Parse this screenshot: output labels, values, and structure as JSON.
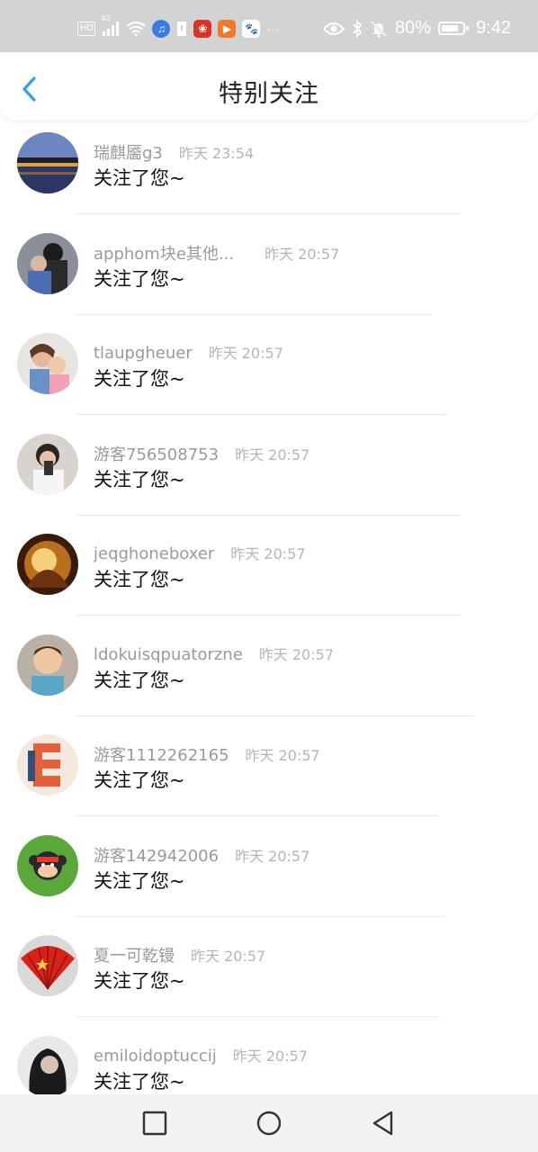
{
  "status_bar": {
    "hd": "HD",
    "network": "4G",
    "battery_text": "80%",
    "battery_level": 0.8,
    "time": "9:42",
    "more": "···",
    "icons": [
      "hd-icon",
      "signal-icon",
      "wifi-icon",
      "music-app-icon",
      "sim-icon",
      "huawei-app-icon",
      "video-app-icon",
      "baidu-app-icon",
      "eye-icon",
      "bluetooth-icon",
      "mute-bell-icon",
      "battery-icon"
    ]
  },
  "header": {
    "title": "特别关注",
    "back_icon": "chevron-left-icon",
    "accent_color": "#2f9ff0"
  },
  "list": {
    "items": [
      {
        "name": "瑞麒靥g3",
        "time": "昨天 23:54",
        "message": "关注了您~",
        "avatar": "lake-night-avatar"
      },
      {
        "name": "apphom块e其他...",
        "time": "昨天 20:57",
        "message": "关注了您~",
        "avatar": "couple-photo-avatar"
      },
      {
        "name": "tlaupgheuer",
        "time": "昨天 20:57",
        "message": "关注了您~",
        "avatar": "mother-child-avatar"
      },
      {
        "name": "游客756508753",
        "time": "昨天 20:57",
        "message": "关注了您~",
        "avatar": "selfie-avatar"
      },
      {
        "name": "jeqghoneboxer",
        "time": "昨天 20:57",
        "message": "关注了您~",
        "avatar": "fire-girl-avatar"
      },
      {
        "name": "ldokuisqpuatorzne",
        "time": "昨天 20:57",
        "message": "关注了您~",
        "avatar": "boy-avatar"
      },
      {
        "name": "游客1112262165",
        "time": "昨天 20:57",
        "message": "关注了您~",
        "avatar": "letter-e-avatar"
      },
      {
        "name": "游客142942006",
        "time": "昨天 20:57",
        "message": "关注了您~",
        "avatar": "monkey-cartoon-avatar"
      },
      {
        "name": "夏一可乾镘",
        "time": "昨天 20:57",
        "message": "关注了您~",
        "avatar": "china-fan-avatar"
      },
      {
        "name": "emiloidoptuccij",
        "time": "昨天 20:57",
        "message": "关注了您~",
        "avatar": "woman-portrait-avatar"
      }
    ]
  },
  "nav_bar": {
    "buttons": [
      "recent-apps-icon",
      "home-icon",
      "back-icon"
    ]
  }
}
